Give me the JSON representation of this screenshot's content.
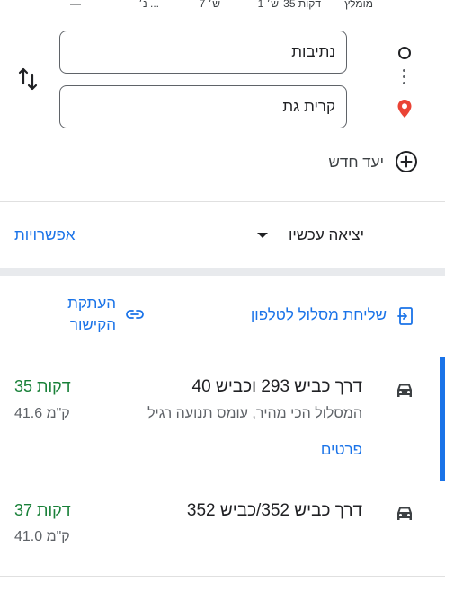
{
  "top_strip": {
    "items": [
      "מומלץ",
      "35 דקות",
      "1 ש׳",
      "7 ש׳",
      "נ׳ ...",
      "—"
    ]
  },
  "directions": {
    "origin_value": "נתיבות",
    "destination_value": "קרית גת",
    "add_destination_label": "יעד חדש"
  },
  "options_bar": {
    "depart_label": "יציאה עכשיו",
    "options_label": "אפשרויות"
  },
  "share": {
    "send_to_phone_label": "שליחת מסלול לטלפון",
    "copy_link_label": "העתקת הקישור"
  },
  "routes": [
    {
      "title": "דרך כביש 293 וכביש 40",
      "subtitle": "המסלול הכי מהיר, עומס תנועה רגיל",
      "time": "35 דקות",
      "distance": "41.6 ק\"מ",
      "details_label": "פרטים",
      "selected": true
    },
    {
      "title": "דרך כביש 352/כביש 352",
      "time": "37 דקות",
      "distance": "41.0 ק\"מ",
      "selected": false
    }
  ],
  "colors": {
    "accent": "#1a73e8",
    "time_green": "#188038",
    "pin_red": "#ea4335"
  }
}
